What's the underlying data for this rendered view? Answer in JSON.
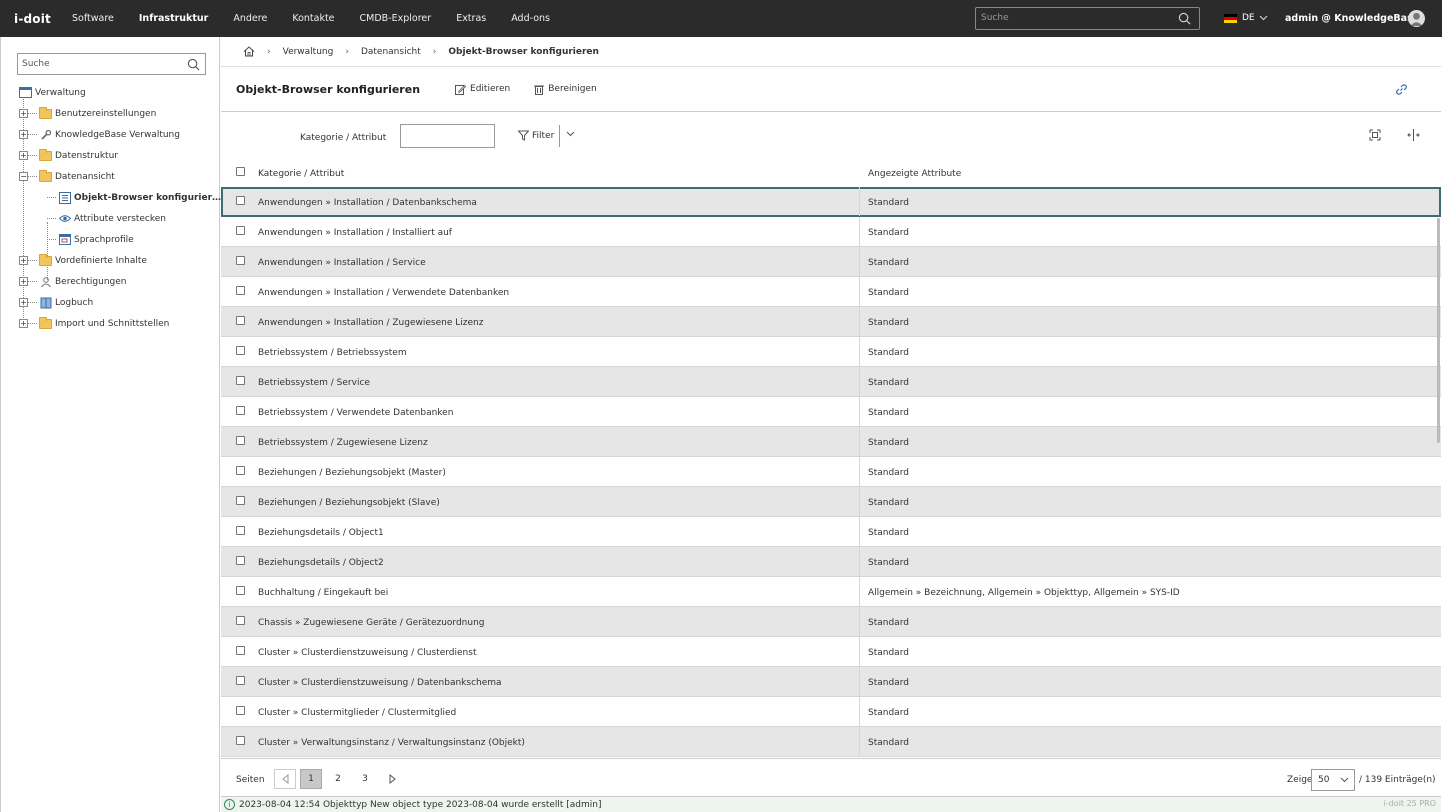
{
  "topbar": {
    "logo": "i-doit",
    "nav": [
      {
        "label": "Software",
        "active": false
      },
      {
        "label": "Infrastruktur",
        "active": true
      },
      {
        "label": "Andere",
        "active": false
      },
      {
        "label": "Kontakte",
        "active": false
      },
      {
        "label": "CMDB-Explorer",
        "active": false
      },
      {
        "label": "Extras",
        "active": false
      },
      {
        "label": "Add-ons",
        "active": false
      }
    ],
    "search_placeholder": "Suche",
    "language": "DE",
    "user": "admin @ KnowledgeBase"
  },
  "sidebar": {
    "search_placeholder": "Suche",
    "root": "Verwaltung",
    "items": [
      {
        "label": "Benutzereinstellungen",
        "icon": "folder-icon"
      },
      {
        "label": "KnowledgeBase Verwaltung",
        "icon": "wrench-icon"
      },
      {
        "label": "Datenstruktur",
        "icon": "folder-icon"
      },
      {
        "label": "Datenansicht",
        "icon": "folder-icon"
      },
      {
        "label": "Objekt-Browser konfigurier…",
        "icon": "list-icon"
      },
      {
        "label": "Attribute verstecken",
        "icon": "eye-icon"
      },
      {
        "label": "Sprachprofile",
        "icon": "window-icon"
      },
      {
        "label": "Vordefinierte Inhalte",
        "icon": "folder-icon"
      },
      {
        "label": "Berechtigungen",
        "icon": "users-icon"
      },
      {
        "label": "Logbuch",
        "icon": "book-icon"
      },
      {
        "label": "Import und Schnittstellen",
        "icon": "folder-icon"
      }
    ]
  },
  "breadcrumb": {
    "items": [
      "Verwaltung",
      "Datenansicht"
    ],
    "current": "Objekt-Browser konfigurieren"
  },
  "page": {
    "title": "Objekt-Browser konfigurieren",
    "edit_label": "Editieren",
    "clean_label": "Bereinigen"
  },
  "filter": {
    "label": "Kategorie / Attribut",
    "value": "",
    "button_label": "Filter"
  },
  "table": {
    "columns": [
      "Kategorie / Attribut",
      "Angezeigte Attribute"
    ],
    "rows": [
      [
        "Anwendungen » Installation / Datenbankschema",
        "Standard"
      ],
      [
        "Anwendungen » Installation / Installiert auf",
        "Standard"
      ],
      [
        "Anwendungen » Installation / Service",
        "Standard"
      ],
      [
        "Anwendungen » Installation / Verwendete Datenbanken",
        "Standard"
      ],
      [
        "Anwendungen » Installation / Zugewiesene Lizenz",
        "Standard"
      ],
      [
        "Betriebssystem / Betriebssystem",
        "Standard"
      ],
      [
        "Betriebssystem / Service",
        "Standard"
      ],
      [
        "Betriebssystem / Verwendete Datenbanken",
        "Standard"
      ],
      [
        "Betriebssystem / Zugewiesene Lizenz",
        "Standard"
      ],
      [
        "Beziehungen / Beziehungsobjekt (Master)",
        "Standard"
      ],
      [
        "Beziehungen / Beziehungsobjekt (Slave)",
        "Standard"
      ],
      [
        "Beziehungsdetails / Object1",
        "Standard"
      ],
      [
        "Beziehungsdetails / Object2",
        "Standard"
      ],
      [
        "Buchhaltung / Eingekauft bei",
        "Allgemein » Bezeichnung, Allgemein » Objekttyp, Allgemein » SYS-ID"
      ],
      [
        "Chassis » Zugewiesene Geräte / Gerätezuordnung",
        "Standard"
      ],
      [
        "Cluster » Clusterdienstzuweisung / Clusterdienst",
        "Standard"
      ],
      [
        "Cluster » Clusterdienstzuweisung / Datenbankschema",
        "Standard"
      ],
      [
        "Cluster » Clustermitglieder / Clustermitglied",
        "Standard"
      ],
      [
        "Cluster » Verwaltungsinstanz / Verwaltungsinstanz (Objekt)",
        "Standard"
      ]
    ]
  },
  "pager": {
    "label": "Seiten",
    "pages": [
      "1",
      "2",
      "3"
    ],
    "current": "1",
    "show_label": "Zeige",
    "page_size": "50",
    "count": "/ 139 Einträge(n)"
  },
  "status": {
    "message": "2023-08-04 12:54 Objekttyp New object type 2023-08-04 wurde erstellt [admin]",
    "version": "i-doit 25 PRO"
  },
  "colors": {
    "topbar": "#2b2b2b",
    "row_alt": "#e6e6e6",
    "selected_outline": "#3d6b76"
  }
}
